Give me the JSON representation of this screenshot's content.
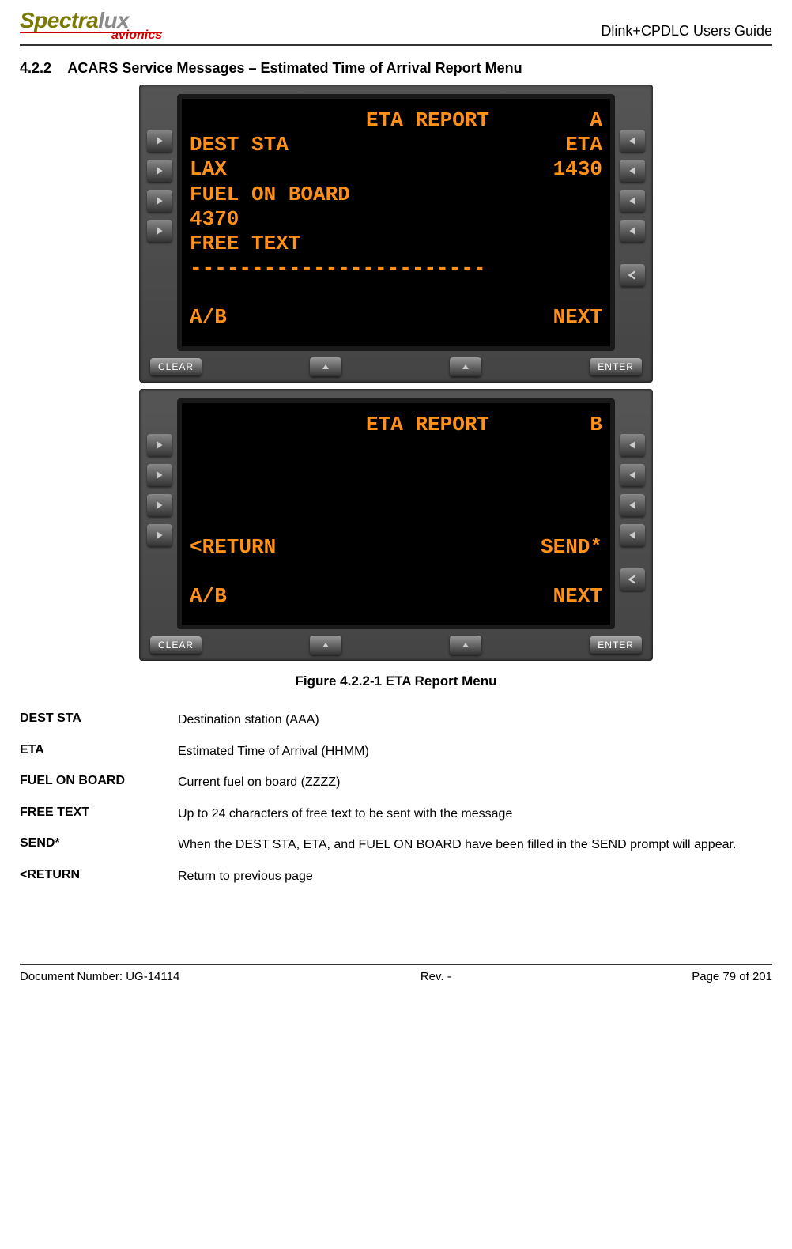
{
  "header": {
    "logo_main_a": "Spectra",
    "logo_main_b": "lux",
    "logo_sub": "avionics",
    "doc_title": "Dlink+CPDLC Users Guide"
  },
  "section": {
    "number": "4.2.2",
    "title": "ACARS Service Messages – Estimated Time of Arrival Report Menu"
  },
  "screen_a": {
    "title": "ETA REPORT",
    "page": "A",
    "l2_left": "DEST STA",
    "l2_right": "ETA",
    "l3_left": "LAX",
    "l3_right": "1430",
    "l4": "FUEL ON BOARD",
    "l5": "4370",
    "l6": "FREE TEXT",
    "l7": "------------------------",
    "l9_left": "A/B",
    "l9_right": "NEXT"
  },
  "screen_b": {
    "title": "ETA REPORT",
    "page": "B",
    "l6_left": "<RETURN",
    "l6_right": "SEND*",
    "l9_left": "A/B",
    "l9_right": "NEXT"
  },
  "device_buttons": {
    "clear": "CLEAR",
    "enter": "ENTER"
  },
  "figure_caption": "Figure 4.2.2-1 ETA Report Menu",
  "definitions": [
    {
      "term": "DEST STA",
      "desc": "Destination station (AAA)"
    },
    {
      "term": "ETA",
      "desc": "Estimated Time of Arrival (HHMM)"
    },
    {
      "term": "FUEL ON BOARD",
      "desc": "Current fuel on board (ZZZZ)"
    },
    {
      "term": "FREE TEXT",
      "desc": "Up to 24 characters of free text to be sent with the message"
    },
    {
      "term": "SEND*",
      "desc": "When the DEST STA, ETA, and FUEL ON BOARD have been filled in the SEND prompt will appear."
    },
    {
      "term": "<RETURN",
      "desc": "Return to previous page"
    }
  ],
  "footer": {
    "left": "Document Number:  UG-14114",
    "center": "Rev. -",
    "right": "Page 79 of 201"
  }
}
